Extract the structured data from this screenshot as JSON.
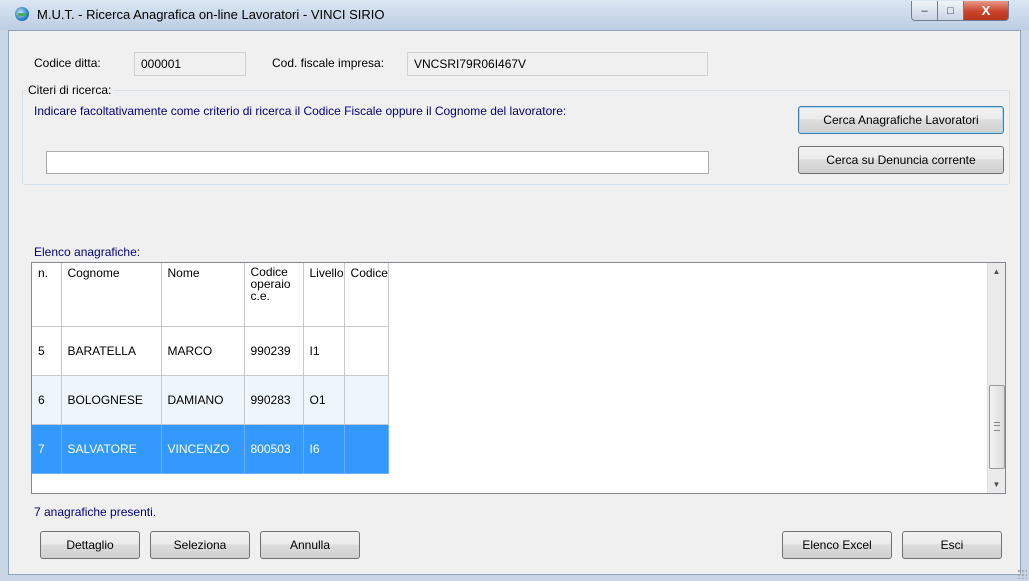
{
  "window": {
    "title": "M.U.T. - Ricerca Anagrafica on-line Lavoratori - VINCI SIRIO",
    "controls": {
      "minimize": "–",
      "maximize": "□",
      "close": "X"
    }
  },
  "company": {
    "code_label": "Codice ditta:",
    "code_value": "000001",
    "fiscal_label": "Cod. fiscale impresa:",
    "fiscal_value": "VNCSRI79R06I467V"
  },
  "search": {
    "group_title": "Citeri di ricerca:",
    "hint": "Indicare facoltativamente come criterio di ricerca il Codice Fiscale oppure il Cognome del lavoratore:",
    "input_value": "",
    "search_registry_button": "Cerca Anagrafiche Lavoratori",
    "search_current_button": "Cerca su Denuncia corrente"
  },
  "list": {
    "title": "Elenco anagrafiche:",
    "columns": [
      "n.",
      "Cognome",
      "Nome",
      "Codice operaio c.e.",
      "Livello",
      "Codice"
    ],
    "rows": [
      {
        "n": "5",
        "cognome": "BARATELLA",
        "nome": "MARCO",
        "codice": "990239",
        "livello": "I1",
        "extra": ""
      },
      {
        "n": "6",
        "cognome": "BOLOGNESE",
        "nome": "DAMIANO",
        "codice": "990283",
        "livello": "O1",
        "extra": ""
      },
      {
        "n": "7",
        "cognome": "SALVATORE",
        "nome": "VINCENZO",
        "codice": "800503",
        "livello": "I6",
        "extra": ""
      }
    ],
    "selected_row": 2,
    "count_text": "7 anagrafiche presenti."
  },
  "footer": {
    "detail_button": "Dettaglio",
    "select_button": "Seleziona",
    "cancel_button": "Annulla",
    "excel_button": "Elenco Excel",
    "exit_button": "Esci"
  },
  "colors": {
    "selection": "#3399ff",
    "hint_text": "#000080",
    "close_button": "#c9442b"
  }
}
